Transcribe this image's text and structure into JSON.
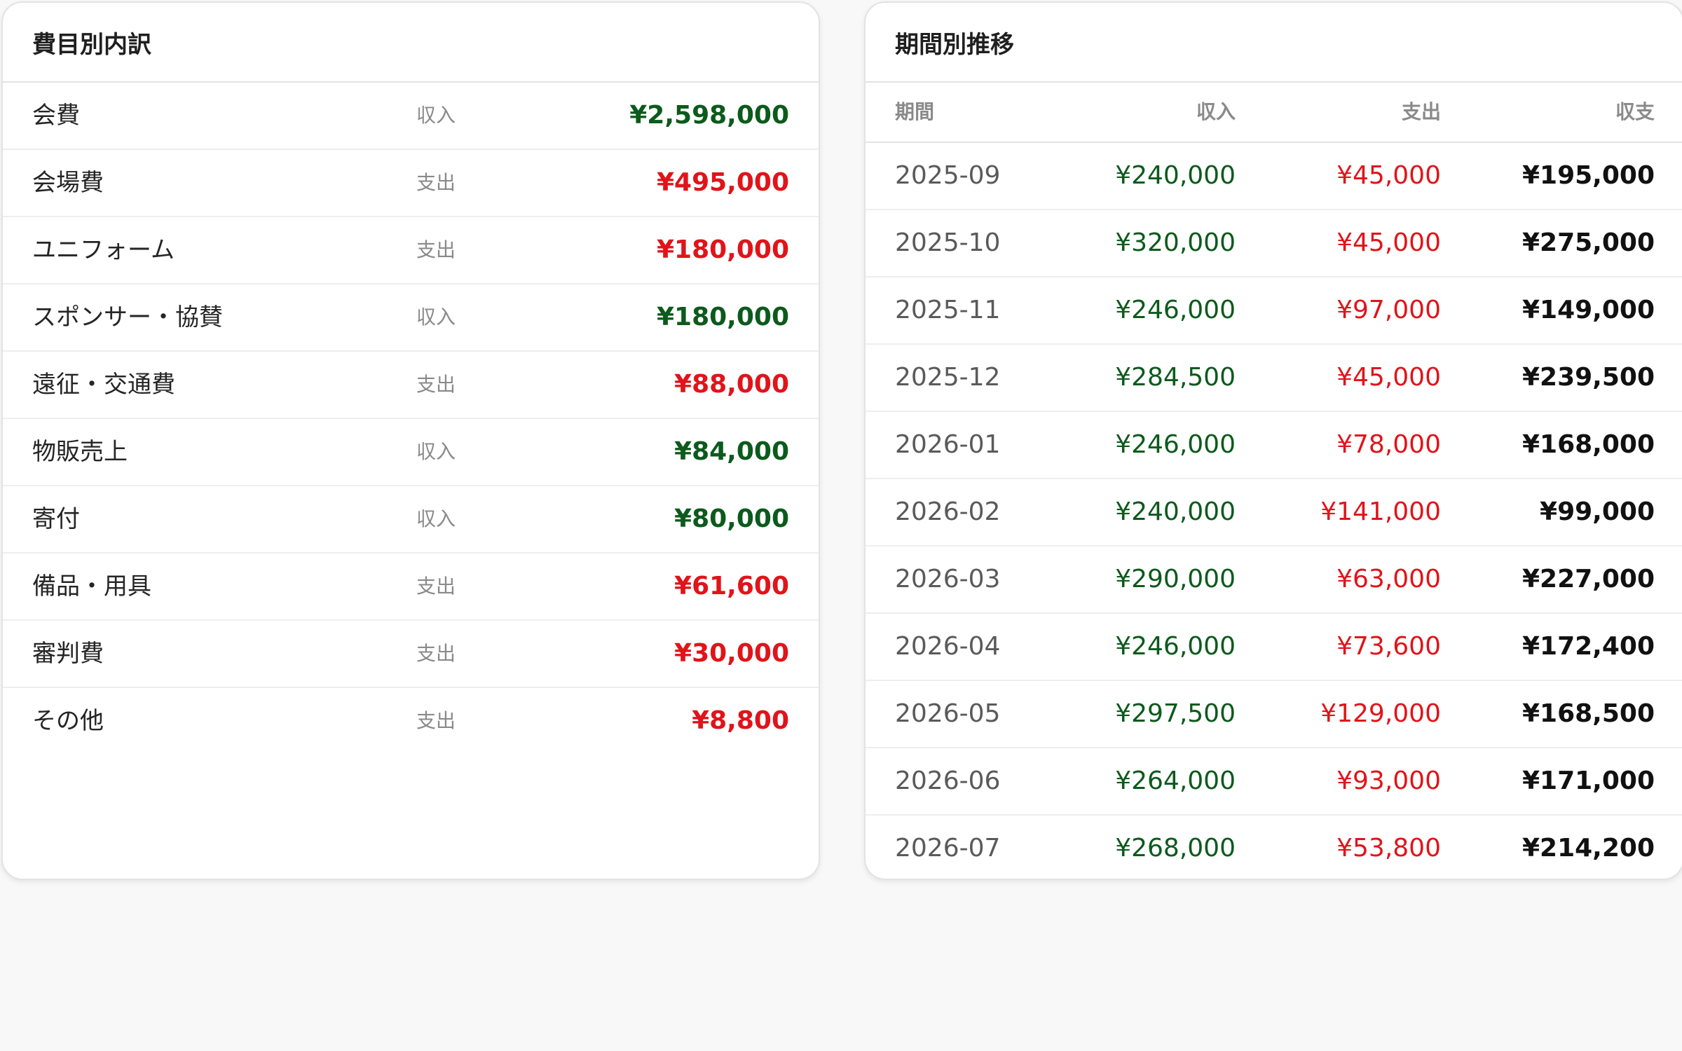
{
  "breakdown": {
    "title": "費目別内訳",
    "items": [
      {
        "label": "会費",
        "type": "収入",
        "amount": "¥2,598,000",
        "kind": "inc"
      },
      {
        "label": "会場費",
        "type": "支出",
        "amount": "¥495,000",
        "kind": "exp"
      },
      {
        "label": "ユニフォーム",
        "type": "支出",
        "amount": "¥180,000",
        "kind": "exp"
      },
      {
        "label": "スポンサー・協賛",
        "type": "収入",
        "amount": "¥180,000",
        "kind": "inc"
      },
      {
        "label": "遠征・交通費",
        "type": "支出",
        "amount": "¥88,000",
        "kind": "exp"
      },
      {
        "label": "物販売上",
        "type": "収入",
        "amount": "¥84,000",
        "kind": "inc"
      },
      {
        "label": "寄付",
        "type": "収入",
        "amount": "¥80,000",
        "kind": "inc"
      },
      {
        "label": "備品・用具",
        "type": "支出",
        "amount": "¥61,600",
        "kind": "exp"
      },
      {
        "label": "審判費",
        "type": "支出",
        "amount": "¥30,000",
        "kind": "exp"
      },
      {
        "label": "その他",
        "type": "支出",
        "amount": "¥8,800",
        "kind": "exp"
      }
    ]
  },
  "trend": {
    "title": "期間別推移",
    "headers": {
      "period": "期間",
      "income": "収入",
      "expense": "支出",
      "balance": "収支"
    },
    "rows": [
      {
        "period": "2025-09",
        "income": "¥240,000",
        "expense": "¥45,000",
        "balance": "¥195,000"
      },
      {
        "period": "2025-10",
        "income": "¥320,000",
        "expense": "¥45,000",
        "balance": "¥275,000"
      },
      {
        "period": "2025-11",
        "income": "¥246,000",
        "expense": "¥97,000",
        "balance": "¥149,000"
      },
      {
        "period": "2025-12",
        "income": "¥284,500",
        "expense": "¥45,000",
        "balance": "¥239,500"
      },
      {
        "period": "2026-01",
        "income": "¥246,000",
        "expense": "¥78,000",
        "balance": "¥168,000"
      },
      {
        "period": "2026-02",
        "income": "¥240,000",
        "expense": "¥141,000",
        "balance": "¥99,000"
      },
      {
        "period": "2026-03",
        "income": "¥290,000",
        "expense": "¥63,000",
        "balance": "¥227,000"
      },
      {
        "period": "2026-04",
        "income": "¥246,000",
        "expense": "¥73,600",
        "balance": "¥172,400"
      },
      {
        "period": "2026-05",
        "income": "¥297,500",
        "expense": "¥129,000",
        "balance": "¥168,500"
      },
      {
        "period": "2026-06",
        "income": "¥264,000",
        "expense": "¥93,000",
        "balance": "¥171,000"
      },
      {
        "period": "2026-07",
        "income": "¥268,000",
        "expense": "¥53,800",
        "balance": "¥214,200"
      }
    ]
  },
  "colors": {
    "income": "#0c5a1c",
    "expense": "#e0141a",
    "balance": "#111111"
  }
}
